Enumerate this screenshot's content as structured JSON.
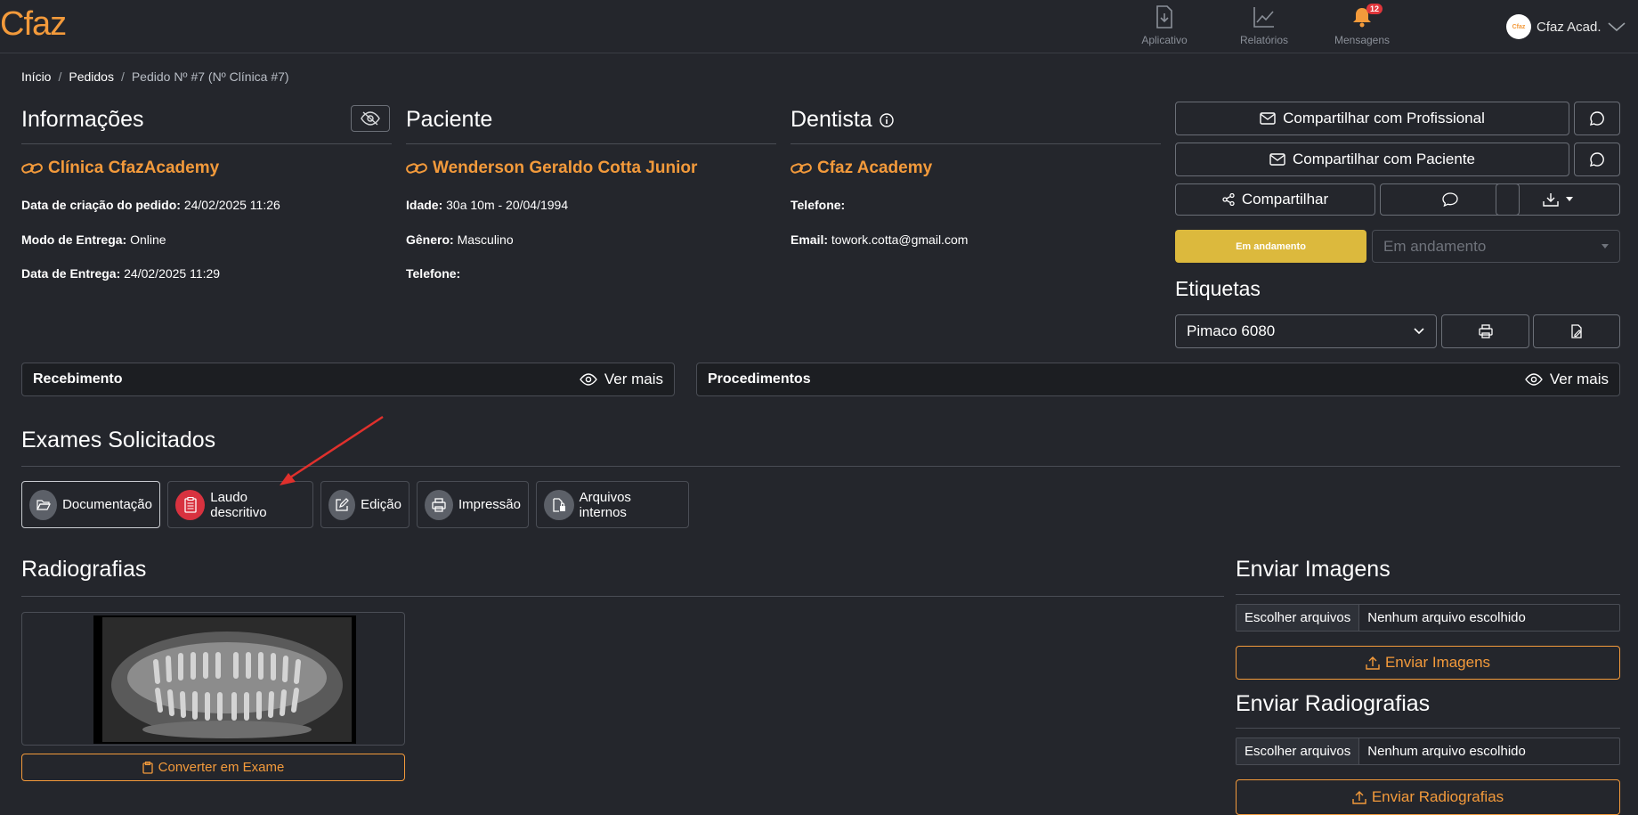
{
  "brand": "Cfaz",
  "nav": {
    "app": "Aplicativo",
    "reports": "Relatórios",
    "messages": "Mensagens",
    "messages_badge": "12",
    "user": "Cfaz Acad.",
    "avatar_text": "Cfaz"
  },
  "breadcrumb": {
    "home": "Início",
    "orders": "Pedidos",
    "current": "Pedido Nº #7 (Nº Clínica #7)",
    "sep": "/"
  },
  "info": {
    "title": "Informações",
    "clinic": "Clínica CfazAcademy",
    "created_label": "Data de criação do pedido:",
    "created_value": "24/02/2025 11:26",
    "delivery_mode_label": "Modo de Entrega:",
    "delivery_mode_value": "Online",
    "delivery_date_label": "Data de Entrega:",
    "delivery_date_value": "24/02/2025 11:29"
  },
  "patient": {
    "title": "Paciente",
    "name": "Wenderson Geraldo Cotta Junior",
    "age_label": "Idade:",
    "age_value": "30a 10m - 20/04/1994",
    "gender_label": "Gênero:",
    "gender_value": "Masculino",
    "phone_label": "Telefone:"
  },
  "dentist": {
    "title": "Dentista",
    "name": "Cfaz Academy",
    "phone_label": "Telefone:",
    "email_label": "Email:",
    "email_value": "towork.cotta@gmail.com"
  },
  "actions": {
    "share_professional": "Compartilhar com Profissional",
    "share_patient": "Compartilhar com Paciente",
    "share": "Compartilhar",
    "status_button": "Em andamento",
    "status_select": "Em andamento"
  },
  "labels": {
    "title": "Etiquetas",
    "selected": "Pimaco 6080"
  },
  "receipt": {
    "title": "Recebimento",
    "more": "Ver mais"
  },
  "procedures": {
    "title": "Procedimentos",
    "more": "Ver mais"
  },
  "exams": {
    "title": "Exames Solicitados",
    "tabs": [
      "Documentação",
      "Laudo descritivo",
      "Edição",
      "Impressão",
      "Arquivos internos"
    ]
  },
  "radiographs": {
    "title": "Radiografias",
    "convert": "Converter em Exame"
  },
  "send_images": {
    "title": "Enviar Imagens",
    "choose": "Escolher arquivos",
    "none": "Nenhum arquivo escolhido",
    "button": "Enviar Imagens"
  },
  "send_radiographs": {
    "title": "Enviar Radiografias",
    "choose": "Escolher arquivos",
    "none": "Nenhum arquivo escolhido",
    "button": "Enviar Radiografias"
  },
  "colors": {
    "background": "#24262c",
    "accent": "#f39a3b",
    "status": "#dcb93d",
    "danger": "#d8323f"
  }
}
